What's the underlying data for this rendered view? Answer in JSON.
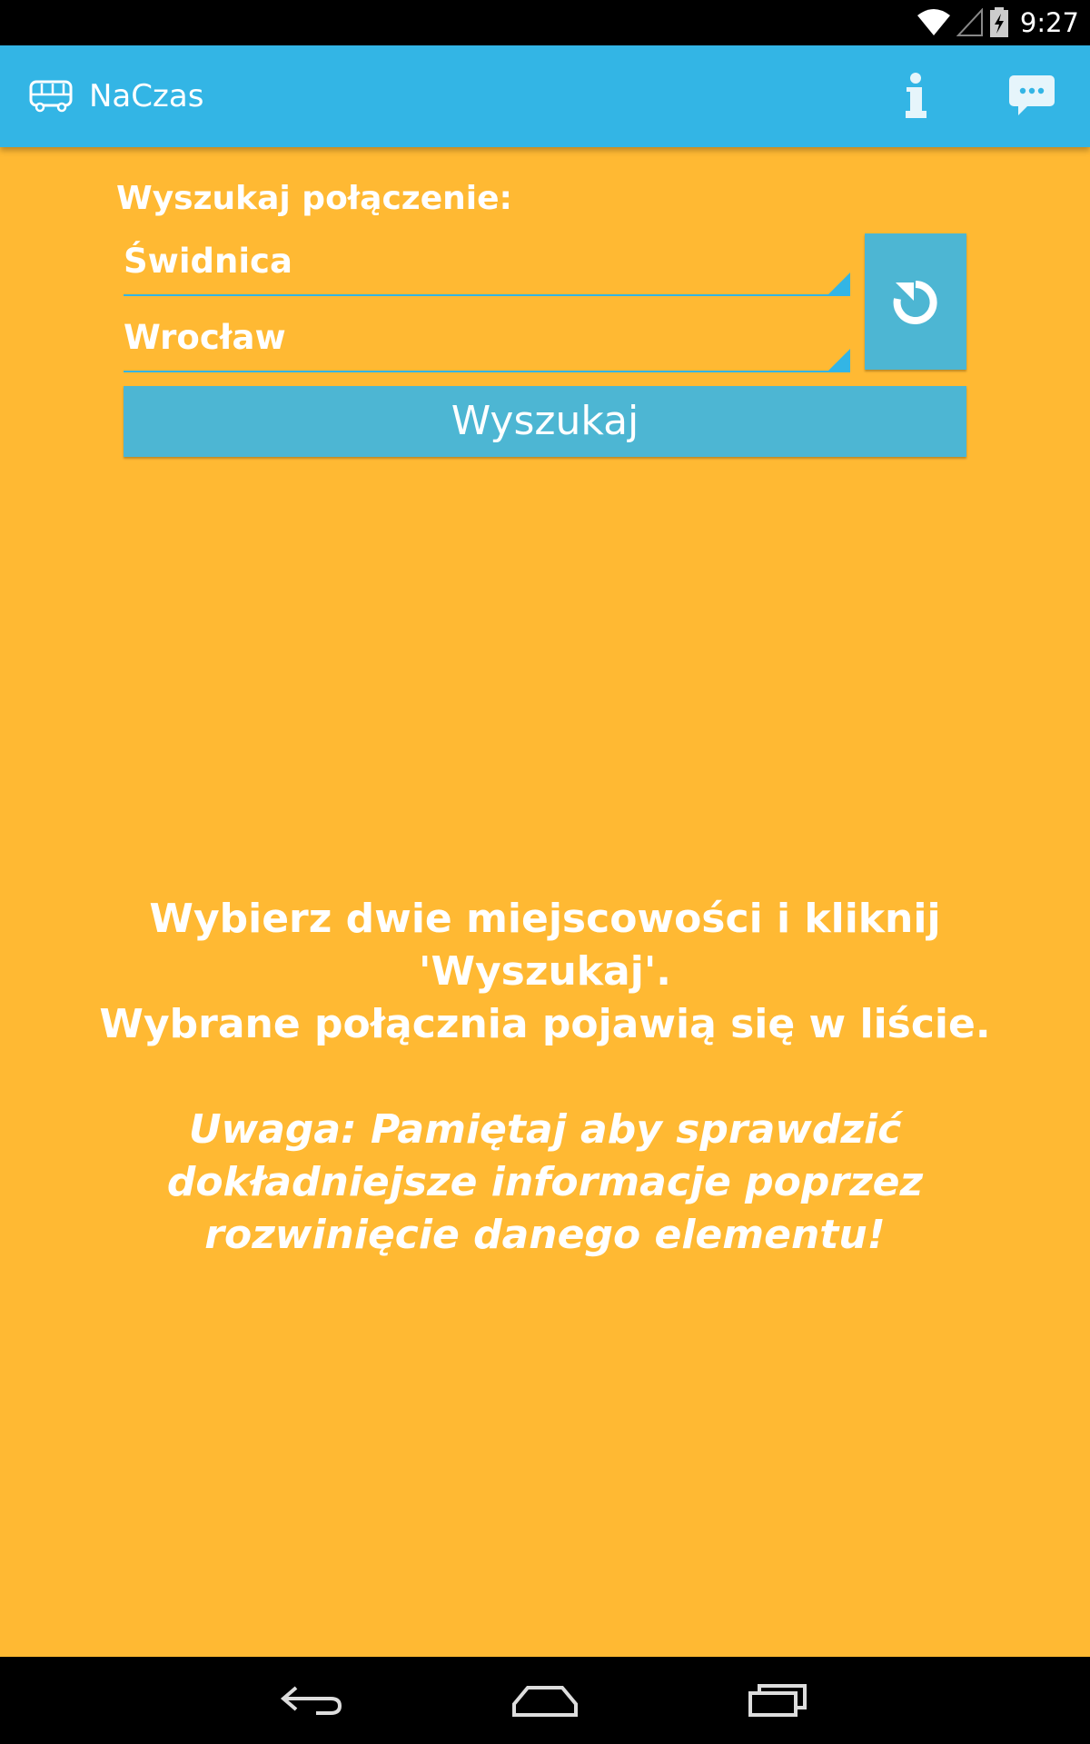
{
  "status_bar": {
    "time": "9:27",
    "icons": [
      "wifi-icon",
      "cell-signal-icon",
      "battery-charging-icon"
    ]
  },
  "action_bar": {
    "title": "NaCzas",
    "app_icon": "bus-icon",
    "actions": [
      "info-icon",
      "chat-icon"
    ],
    "color": "#33B5E5"
  },
  "form": {
    "label": "Wyszukaj połączenie:",
    "from_value": "Świdnica",
    "to_value": "Wrocław",
    "swap_icon": "swap-arrow-icon",
    "search_label": "Wyszukaj",
    "button_color": "#4DB6D3"
  },
  "message": {
    "hint_line1": "Wybierz dwie miejscowości i kliknij",
    "hint_line2": "'Wyszukaj'.",
    "hint_line3": "Wybrane połącznia pojawią się w liście.",
    "warning_line1": "Uwaga: Pamiętaj aby sprawdzić",
    "warning_line2": "dokładniejsze informacje poprzez",
    "warning_line3": "rozwinięcie danego elementu!"
  },
  "background_color": "#FFB933",
  "nav_bar": {
    "buttons": [
      "back-icon",
      "home-icon",
      "recents-icon"
    ]
  }
}
